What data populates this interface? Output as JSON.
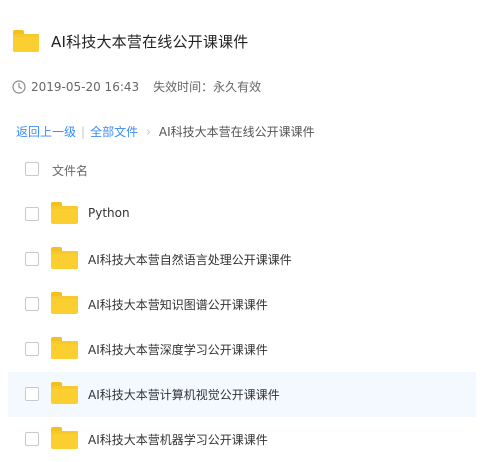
{
  "share": {
    "title": "AI科技大本营在线公开课课件",
    "date": "2019-05-20 16:43",
    "expire": "失效时间：永久有效"
  },
  "breadcrumb": {
    "back": "返回上一级",
    "all_files": "全部文件",
    "separator": "|",
    "arrow": "›",
    "current": "AI科技大本营在线公开课课件"
  },
  "list": {
    "column_header": "文件名",
    "items": [
      {
        "name": "Python"
      },
      {
        "name": "AI科技大本营自然语言处理公开课课件"
      },
      {
        "name": "AI科技大本营知识图谱公开课课件"
      },
      {
        "name": "AI科技大本营深度学习公开课课件"
      },
      {
        "name": "AI科技大本营计算机视觉公开课课件"
      },
      {
        "name": "AI科技大本营机器学习公开课课件"
      }
    ]
  },
  "icons": {
    "folder": "folder-icon",
    "clock": "clock-icon"
  },
  "colors": {
    "link": "#3b8cff",
    "folder": "#fccf31",
    "hover_row": "#f4f8ff"
  }
}
